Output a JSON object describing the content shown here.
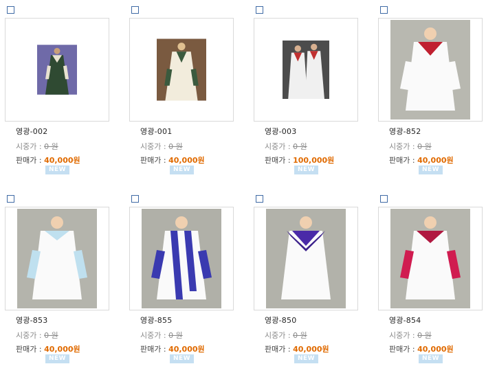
{
  "price_labels": {
    "list": "시중가 : ",
    "sale": "판매가 : "
  },
  "badge_text": "NEW",
  "products": [
    {
      "name": "영광-002",
      "list_price": "0 원",
      "sale_price": "40,000원"
    },
    {
      "name": "영광-001",
      "list_price": "0 원",
      "sale_price": "40,000원"
    },
    {
      "name": "영광-003",
      "list_price": "0 원",
      "sale_price": "100,000원"
    },
    {
      "name": "영광-852",
      "list_price": "0 원",
      "sale_price": "40,000원"
    },
    {
      "name": "영광-853",
      "list_price": "0 원",
      "sale_price": "40,000원"
    },
    {
      "name": "영광-855",
      "list_price": "0 원",
      "sale_price": "40,000원"
    },
    {
      "name": "영광-850",
      "list_price": "0 원",
      "sale_price": "40,000원"
    },
    {
      "name": "영광-854",
      "list_price": "0 원",
      "sale_price": "40,000원"
    }
  ],
  "colors": {
    "sale_price": "#e06a00",
    "badge_bg": "#c5dff2",
    "checkbox_border": "#3f6aa5"
  }
}
